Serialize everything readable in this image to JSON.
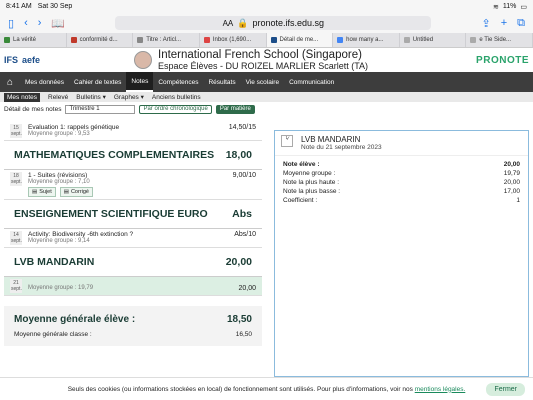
{
  "status": {
    "time": "8:41 AM",
    "date": "Sat 30 Sep",
    "battery": "11%"
  },
  "browser": {
    "url": "pronote.ifs.edu.sg",
    "aa": "AA",
    "tabs": [
      "La vérité",
      "conformité d...",
      "Titre : Articl...",
      "Inbox (1,690...",
      "Détail de me...",
      "how many a...",
      "Untitled",
      "e Tie Side..."
    ],
    "active_tab": 4
  },
  "header": {
    "school": "International French School (Singapore)",
    "subtitle": "Espace Élèves - DU ROIZEL MARLIER Scarlett (TA)",
    "brand": "PRONOTE",
    "logo1": "IFS",
    "logo2": "aefe"
  },
  "nav": {
    "items": [
      "Mes données",
      "Cahier de textes",
      "Notes",
      "Compétences",
      "Résultats",
      "Vie scolaire",
      "Communication"
    ],
    "active": 2
  },
  "subnav": {
    "items": [
      "Mes notes",
      "Relevé",
      "Bulletins ▾",
      "Graphes ▾",
      "Anciens bulletins"
    ]
  },
  "filter": {
    "label": "Détail de mes notes",
    "period": "Trimestre 1",
    "btn1": "Par ordre chronologique",
    "btn2": "Par matière"
  },
  "left": {
    "row0": {
      "date": "15 sept.",
      "title": "Evaluation 1: rappels génétique",
      "sub": "Moyenne groupe : 9,53",
      "grade": "14,50/15"
    },
    "subj1": {
      "name": "MATHEMATIQUES COMPLEMENTAIRES",
      "avg": "18,00"
    },
    "row1": {
      "date": "18 sept.",
      "title": "1 - Suites (révisions)",
      "sub": "Moyenne groupe : 7,10",
      "grade": "9,00/10",
      "b1": "Sujet",
      "b2": "Corrigé"
    },
    "subj2": {
      "name": "ENSEIGNEMENT SCIENTIFIQUE EURO",
      "avg": "Abs"
    },
    "row2": {
      "date": "14 sept.",
      "title": "Activity: Biodiversity -6th extinction ?",
      "sub": "Moyenne groupe : 9,14",
      "grade": "Abs/10"
    },
    "subj3": {
      "name": "LVB MANDARIN",
      "avg": "20,00"
    },
    "row3": {
      "date": "21 sept.",
      "sub": "Moyenne groupe : 19,79",
      "grade": "20,00"
    },
    "summary": {
      "title": "Moyenne générale élève :",
      "value": "18,50",
      "class_label": "Moyenne générale classe :",
      "class_value": "16,50"
    }
  },
  "right": {
    "title": "LVB MANDARIN",
    "date": "Note du 21 septembre 2023",
    "rows": [
      [
        "Note élève :",
        "20,00"
      ],
      [
        "Moyenne groupe :",
        "19,79"
      ],
      [
        "Note la plus haute :",
        "20,00"
      ],
      [
        "Note la plus basse :",
        "17,00"
      ],
      [
        "Coefficient :",
        "1"
      ]
    ]
  },
  "cookie": {
    "text": "Seuls des cookies (ou informations stockées en local) de fonctionnement sont utilisés. Pour plus d'informations, voir nos",
    "link": "mentions légales.",
    "button": "Fermer"
  }
}
